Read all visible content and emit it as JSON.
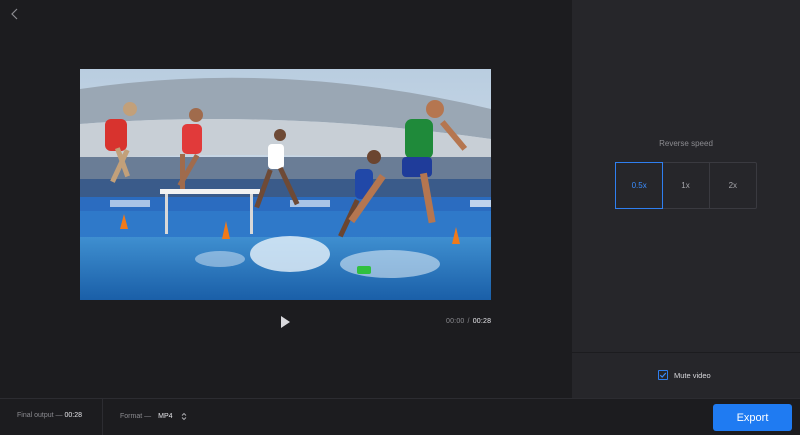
{
  "icons": {
    "back": "chevron-left-icon",
    "play": "play-icon",
    "mute_check": "checkmark-icon",
    "format_arrows": "up-down-chevron-icon"
  },
  "player": {
    "current_time": "00:00",
    "separator": "/",
    "total_time": "00:28"
  },
  "sidebar": {
    "speed_label": "Reverse speed",
    "speeds": [
      "0.5x",
      "1x",
      "2x"
    ],
    "selected_speed": "0.5x",
    "mute_label": "Mute video",
    "mute_checked": true
  },
  "bottom_bar": {
    "final_output_label": "Final output —",
    "final_output_value": "00:28",
    "format_label": "Format —",
    "format_value": "MP4",
    "export_label": "Export"
  },
  "colors": {
    "accent": "#1f7bf2",
    "background": "#1c1c1f",
    "sidebar": "#26262a"
  }
}
